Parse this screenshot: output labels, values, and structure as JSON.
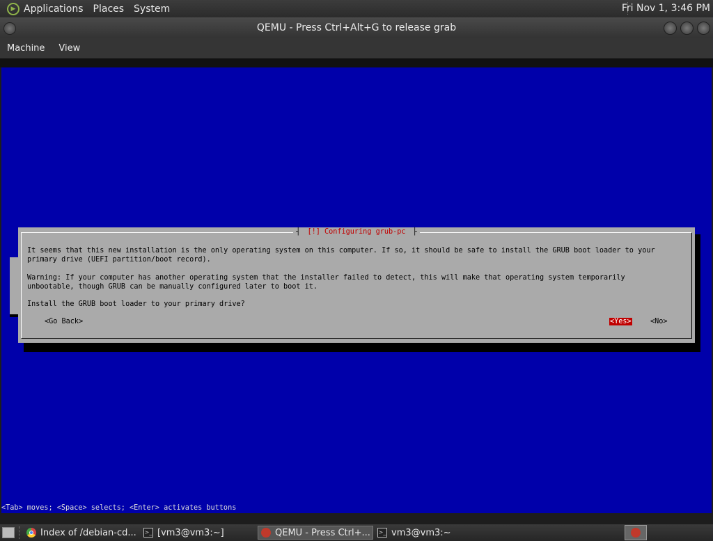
{
  "top_panel": {
    "menus": [
      "Applications",
      "Places",
      "System"
    ],
    "clock": "Fri Nov 1,  3:46 PM"
  },
  "window": {
    "title": "QEMU - Press Ctrl+Alt+G to release grab",
    "menus": [
      "Machine",
      "View"
    ]
  },
  "installer": {
    "dialog_title": "[!] Configuring grub-pc",
    "para1_line1": "It seems that this new installation is the only operating system on this computer. If so, it should be safe to install the GRUB boot loader to your",
    "para1_line2": "primary drive (UEFI partition/boot record).",
    "para2_line1": "Warning: If your computer has another operating system that the installer failed to detect, this will make that operating system temporarily",
    "para2_line2": "unbootable, though GRUB can be manually configured later to boot it.",
    "question": "Install the GRUB boot loader to your primary drive?",
    "go_back": "<Go Back>",
    "yes": "<Yes>",
    "no": "<No>",
    "help_line": "<Tab> moves; <Space> selects; <Enter> activates buttons"
  },
  "taskbar": {
    "tasks": [
      {
        "label": "Index of /debian-cd...",
        "icon": "chrome-icon"
      },
      {
        "label": "[vm3@vm3:~]",
        "icon": "terminal-icon"
      },
      {
        "label": "QEMU - Press Ctrl+...",
        "icon": "qemu-icon"
      },
      {
        "label": "vm3@vm3:~",
        "icon": "terminal-icon"
      }
    ]
  }
}
